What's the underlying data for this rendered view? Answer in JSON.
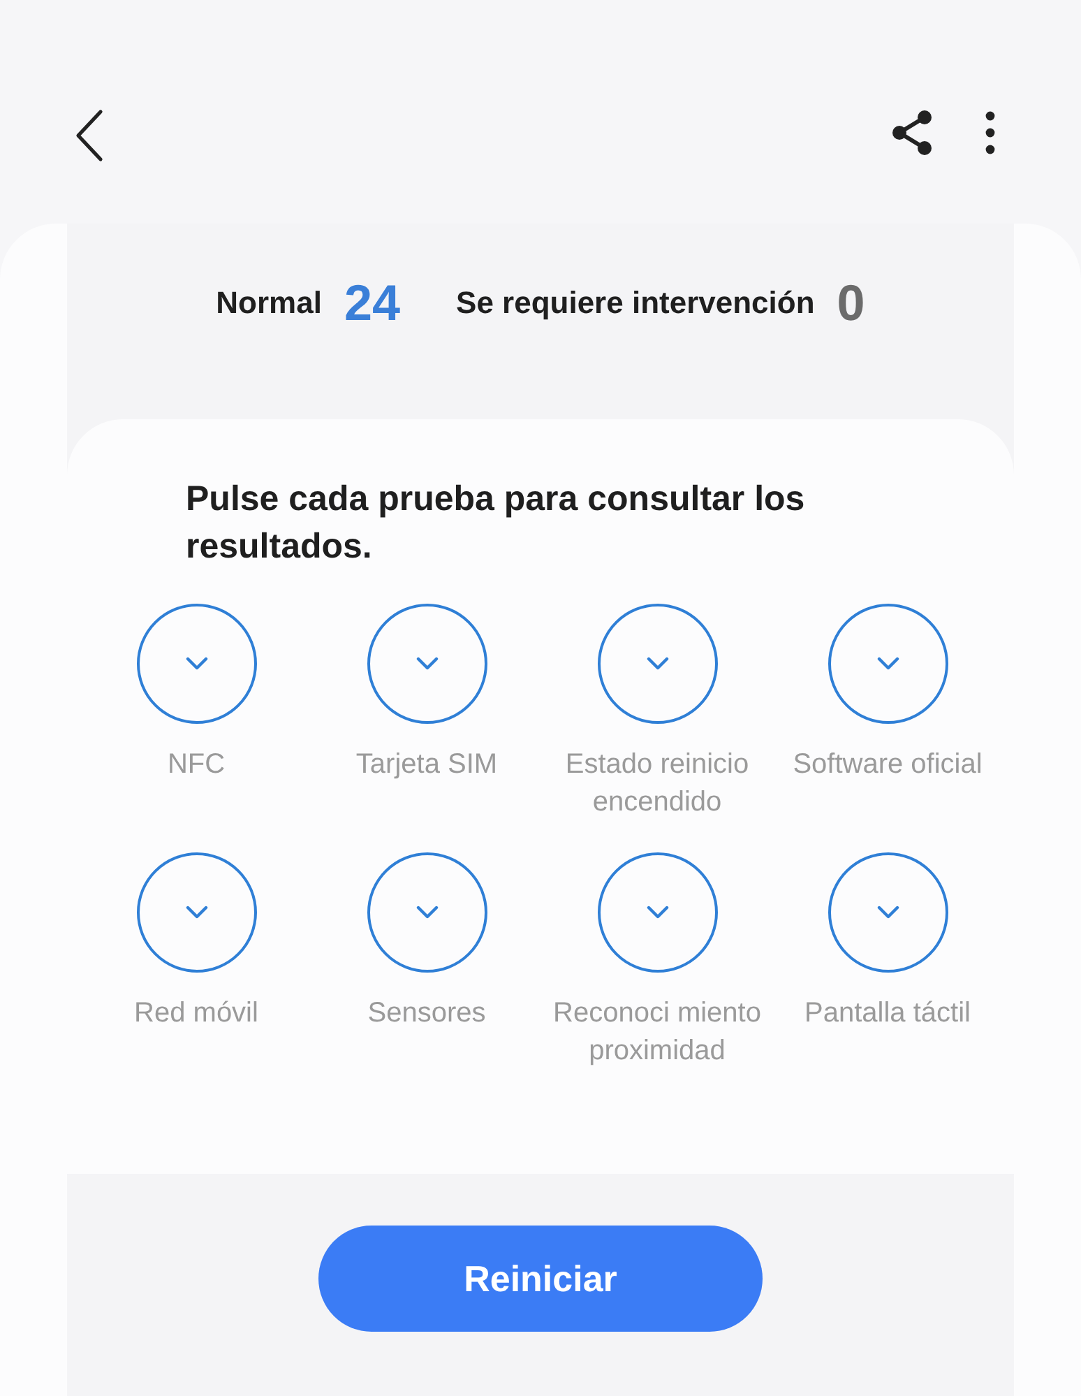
{
  "summary": {
    "normal_label": "Normal",
    "normal_count": "24",
    "attention_label": "Se requiere intervención",
    "attention_count": "0"
  },
  "instructions": "Pulse cada prueba para consultar los resultados.",
  "tests": [
    {
      "label": "NFC",
      "passed": true
    },
    {
      "label": "Tarjeta SIM",
      "passed": true
    },
    {
      "label": "Estado reinicio encendido",
      "passed": true
    },
    {
      "label": "Software oficial",
      "passed": true
    },
    {
      "label": "Red móvil",
      "passed": true
    },
    {
      "label": "Sensores",
      "passed": true
    },
    {
      "label": "Reconoci miento proximidad",
      "passed": true
    },
    {
      "label": "Pantalla táctil",
      "passed": true
    }
  ],
  "button": "Reiniciar"
}
